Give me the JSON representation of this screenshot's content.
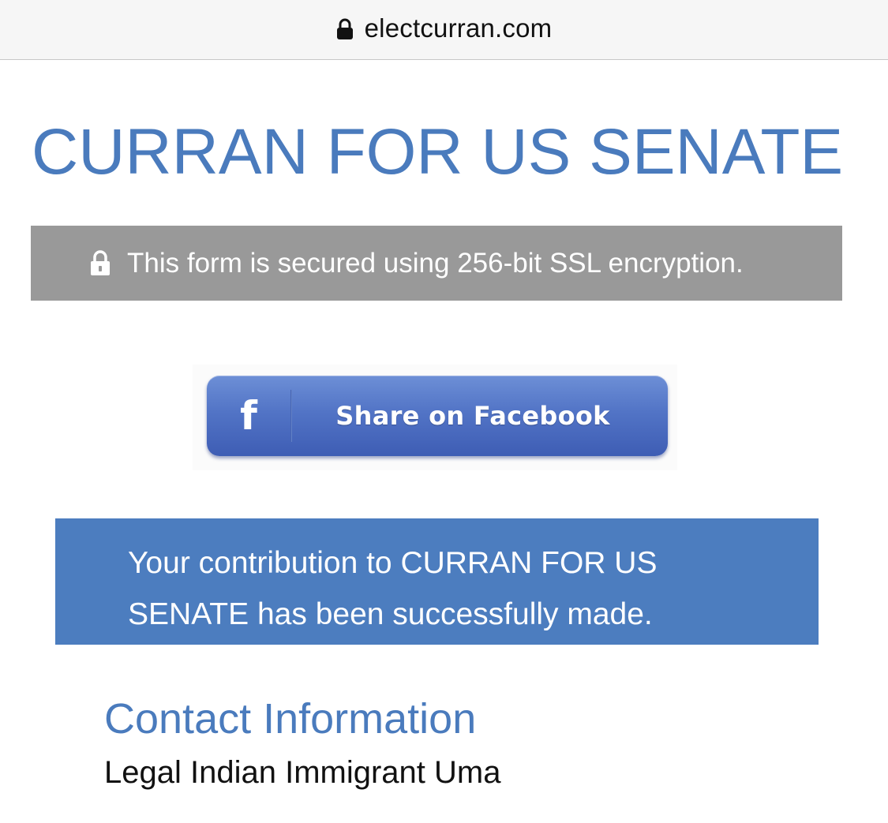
{
  "browser": {
    "url": "electcurran.com",
    "lock_icon": "lock-icon"
  },
  "page": {
    "title": "CURRAN FOR US SENATE",
    "ssl_notice": {
      "icon": "padlock-icon",
      "text": "This form is secured using 256-bit SSL encryption."
    },
    "share_button": {
      "icon": "facebook-f-icon",
      "label": "Share on Facebook"
    },
    "success_message": "Your contribution to CURRAN FOR US SENATE has been successfully made.",
    "contact_section": {
      "heading": "Contact Information",
      "name": "Legal Indian Immigrant Uma"
    }
  },
  "colors": {
    "brand_blue": "#4a7bbd",
    "ssl_bar_gray": "#999999",
    "facebook_blue": "#4f6fc4",
    "success_blue": "#4c7dbf"
  }
}
